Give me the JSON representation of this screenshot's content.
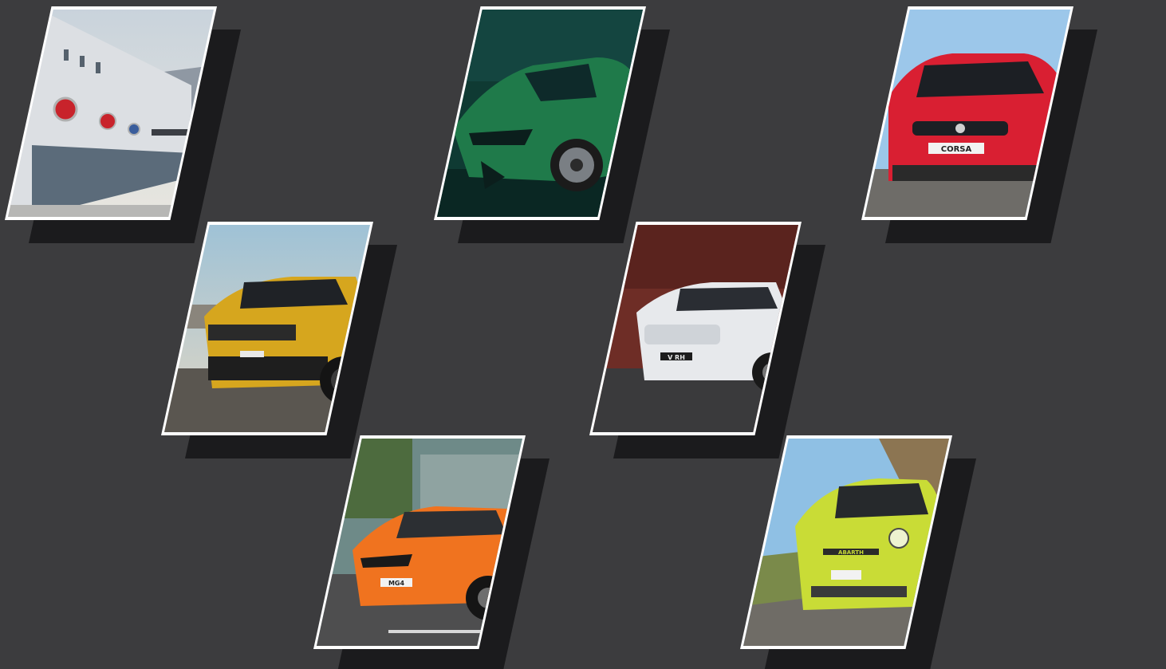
{
  "colors": {
    "background": "#3c3c3e",
    "frame": "#ffffff",
    "shadow": "#1b1b1d"
  },
  "tiles": [
    {
      "subject": "dealership-building",
      "badge": ""
    },
    {
      "subject": "green-suv",
      "badge": ""
    },
    {
      "subject": "red-hatchback",
      "badge": "CORSA"
    },
    {
      "subject": "yellow-suv",
      "badge": ""
    },
    {
      "subject": "white-suv",
      "badge": "V RH"
    },
    {
      "subject": "orange-hatchback",
      "badge": "MG4"
    },
    {
      "subject": "lime-city-car",
      "badge": "ABARTH"
    }
  ]
}
